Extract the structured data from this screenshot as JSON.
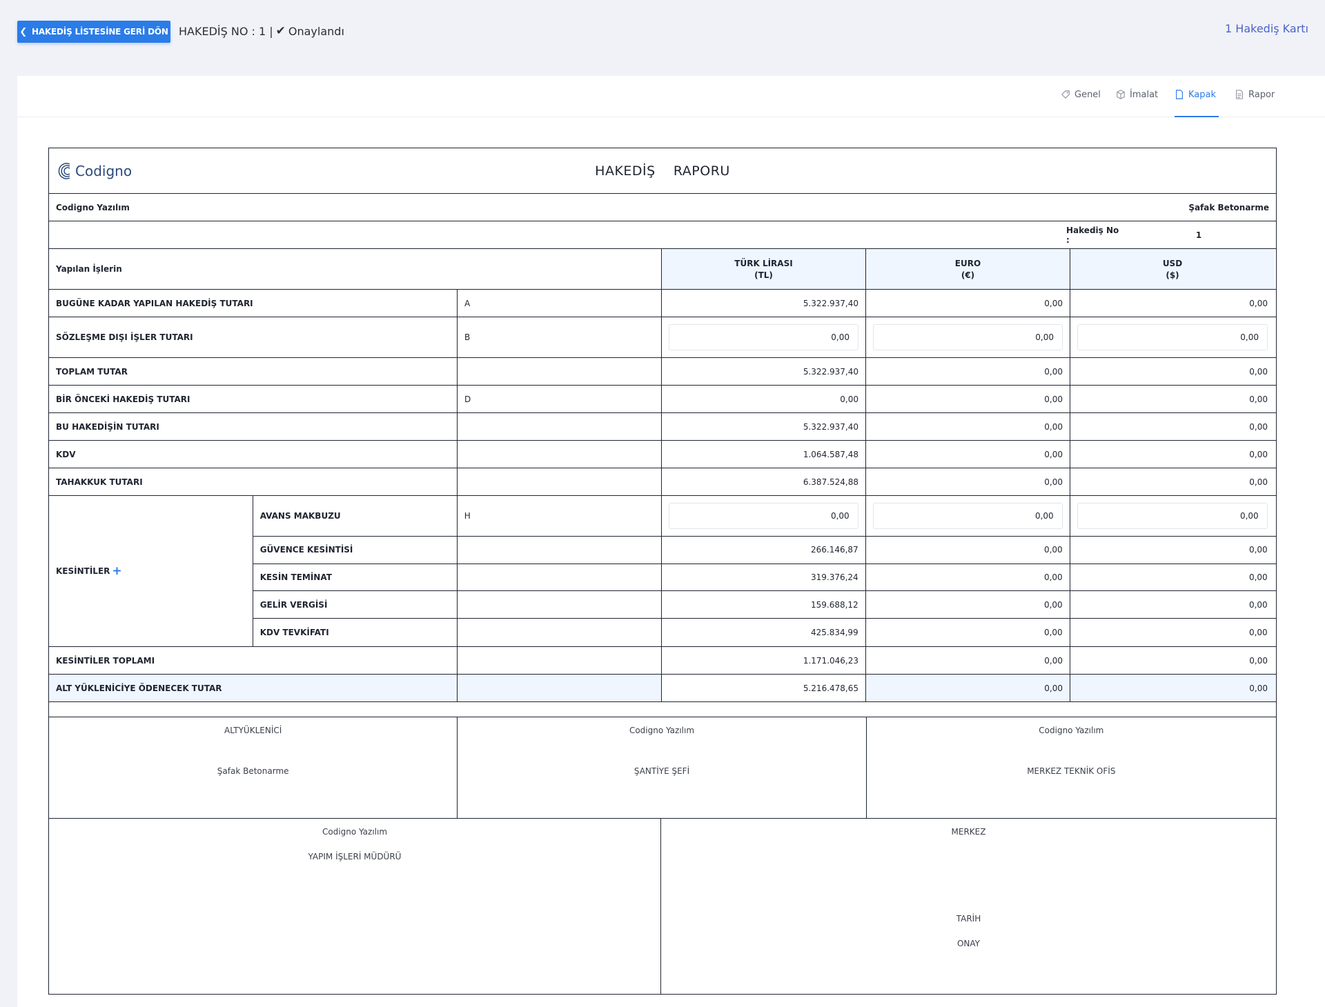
{
  "header": {
    "back_label": "HAKEDİŞ LİSTESİNE GERİ DÖN",
    "breadcrumb_prefix": "HAKEDİŞ NO : 1 |",
    "status": "Onaylandı",
    "card_link": "1 Hakediş Kartı"
  },
  "tabs": [
    {
      "label": "Genel",
      "icon": "tag-icon"
    },
    {
      "label": "İmalat",
      "icon": "box-icon"
    },
    {
      "label": "Kapak",
      "icon": "file-icon"
    },
    {
      "label": "Rapor",
      "icon": "document-icon"
    }
  ],
  "report": {
    "logo_text": "Codigno",
    "title_left": "HAKEDİŞ",
    "title_right": "RAPORU",
    "company_left": "Codigno Yazılım",
    "company_right": "Şafak Betonarme",
    "hakedis_no_label": "Hakediş No :",
    "hakedis_no_value": "1",
    "works_label": "Yapılan İşlerin",
    "col_tl_1": "TÜRK LİRASI",
    "col_tl_2": "(TL)",
    "col_eur_1": "EURO",
    "col_eur_2": "(€)",
    "col_usd_1": "USD",
    "col_usd_2": "($)",
    "rows_top": [
      {
        "label": "BUGÜNE KADAR YAPILAN HAKEDİŞ TUTARI",
        "code": "A",
        "tl": "5.322.937,40",
        "eur": "0,00",
        "usd": "0,00"
      },
      {
        "label": "SÖZLEŞME DIŞI İŞLER TUTARI",
        "code": "B",
        "tl": "0,00",
        "eur": "0,00",
        "usd": "0,00"
      },
      {
        "label": "TOPLAM TUTAR",
        "code": "",
        "tl": "5.322.937,40",
        "eur": "0,00",
        "usd": "0,00"
      },
      {
        "label": "BİR ÖNCEKİ HAKEDİŞ TUTARI",
        "code": "D",
        "tl": "0,00",
        "eur": "0,00",
        "usd": "0,00"
      },
      {
        "label": "BU HAKEDİŞİN TUTARI",
        "code": "",
        "tl": "5.322.937,40",
        "eur": "0,00",
        "usd": "0,00"
      },
      {
        "label": "KDV",
        "code": "",
        "tl": "1.064.587,48",
        "eur": "0,00",
        "usd": "0,00"
      },
      {
        "label": "TAHAKKUK TUTARI",
        "code": "",
        "tl": "6.387.524,88",
        "eur": "0,00",
        "usd": "0,00"
      }
    ],
    "deductions_label": "KESİNTİLER",
    "deductions": [
      {
        "label": "AVANS MAKBUZU",
        "code": "H",
        "tl": "0,00",
        "eur": "0,00",
        "usd": "0,00"
      },
      {
        "label": "GÜVENCE KESİNTİSİ",
        "code": "",
        "tl": "266.146,87",
        "eur": "0,00",
        "usd": "0,00"
      },
      {
        "label": "KESİN TEMİNAT",
        "code": "",
        "tl": "319.376,24",
        "eur": "0,00",
        "usd": "0,00"
      },
      {
        "label": "GELİR VERGİSİ",
        "code": "",
        "tl": "159.688,12",
        "eur": "0,00",
        "usd": "0,00"
      },
      {
        "label": "KDV TEVKİFATI",
        "code": "",
        "tl": "425.834,99",
        "eur": "0,00",
        "usd": "0,00"
      }
    ],
    "total_deductions": {
      "label": "KESİNTİLER TOPLAMI",
      "tl": "1.171.046,23",
      "eur": "0,00",
      "usd": "0,00"
    },
    "payable": {
      "label": "ALT YÜKLENİCİYE ÖDENECEK TUTAR",
      "tl": "5.216.478,65",
      "eur": "0,00",
      "usd": "0,00"
    },
    "signatures_top": [
      {
        "title": "ALTYÜKLENİCİ",
        "name": "Şafak Betonarme"
      },
      {
        "title": "Codigno Yazılım",
        "name": "ŞANTİYE ŞEFİ"
      },
      {
        "title": "Codigno Yazılım",
        "name": "MERKEZ TEKNİK OFİS"
      }
    ],
    "signatures_bottom": {
      "left_title": "Codigno Yazılım",
      "left_name": "YAPIM İŞLERİ MÜDÜRÜ",
      "right_title": "MERKEZ",
      "right_date": "TARİH",
      "right_approval": "ONAY"
    }
  },
  "colors": {
    "accent": "#2a7ce8",
    "highlight": "#eff6ff",
    "link": "#4a64c7"
  }
}
